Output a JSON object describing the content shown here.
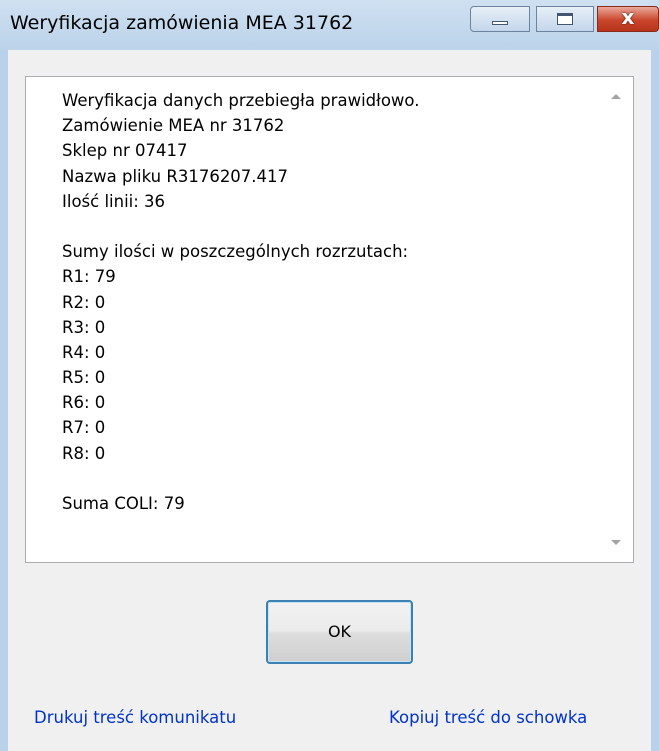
{
  "window": {
    "title": "Weryfikacja zamówienia MEA 31762",
    "controls": {
      "minimize": "minimize-icon",
      "maximize": "maximize-icon",
      "close": "close-icon",
      "close_glyph": "x",
      "close_color": "#c9462c"
    }
  },
  "message": {
    "lines": [
      "Weryfikacja danych przebiegła prawidłowo.",
      "Zamówienie MEA nr 31762",
      "Sklep nr 07417",
      "Nazwa pliku R3176207.417",
      "Ilość linii: 36",
      "",
      "Sumy ilości w poszczególnych rozrzutach:",
      "R1: 79",
      "R2: 0",
      "R3: 0",
      "R4: 0",
      "R5: 0",
      "R6: 0",
      "R7: 0",
      "R8: 0",
      "",
      "Suma COLI: 79"
    ]
  },
  "buttons": {
    "ok_label": "OK"
  },
  "links": {
    "print_label": "Drukuj treść komunikatu",
    "copy_label": "Kopiuj treść do schowka",
    "color": "#0033cc"
  }
}
